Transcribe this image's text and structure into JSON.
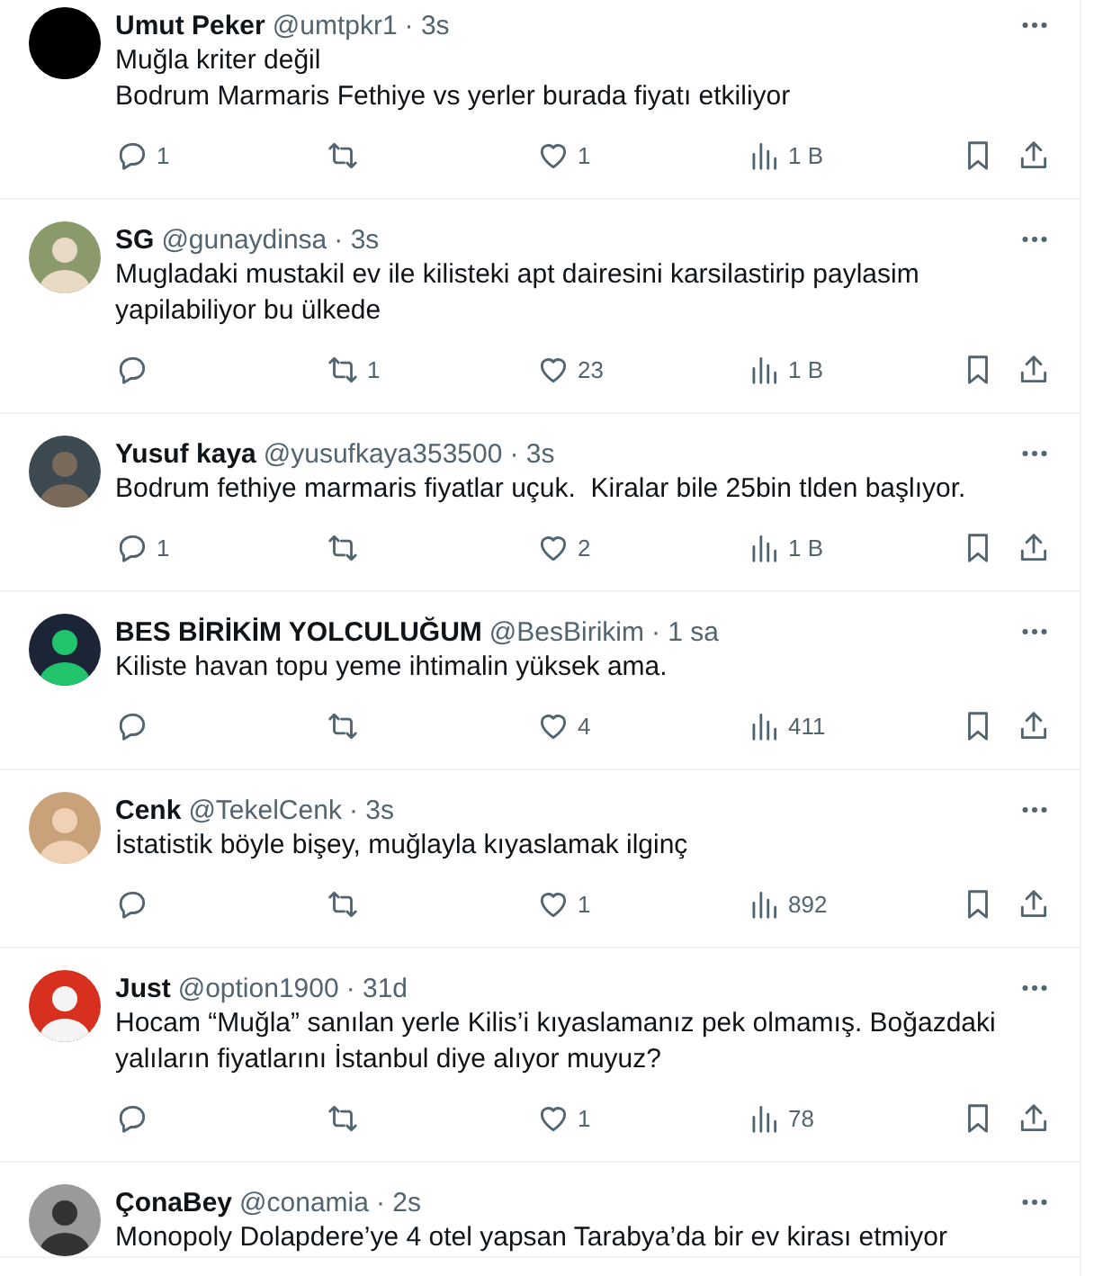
{
  "tweets": [
    {
      "name": "Umut Peker",
      "handle": "@umtpkr1",
      "time": "· 3s",
      "lines": [
        "Muğla kriter değil",
        "Bodrum Marmaris Fethiye vs yerler burada fiyatı etkiliyor"
      ],
      "actions": {
        "replies": "1",
        "likes": "1",
        "views": "1 B"
      }
    },
    {
      "name": "SG",
      "handle": "@gunaydinsa",
      "time": "· 3s",
      "lines": [
        "Mugladaki mustakil ev ile kilisteki apt dairesini karsilastirip paylasim",
        "yapilabiliyor bu ülkede"
      ],
      "actions": {
        "reposts": "1",
        "likes": "23",
        "views": "1 B"
      }
    },
    {
      "name": "Yusuf kaya",
      "handle": "@yusufkaya353500",
      "time": "· 3s",
      "lines": [
        "Bodrum fethiye marmaris fiyatlar uçuk.  Kiralar bile 25bin tlden başlıyor."
      ],
      "actions": {
        "replies": "1",
        "likes": "2",
        "views": "1 B"
      }
    },
    {
      "name": "BES BİRİKİM YOLCULUĞUM",
      "handle": "@BesBirikim",
      "time": "· 1 sa",
      "lines": [
        "Kiliste havan topu yeme ihtimalin yüksek ama."
      ],
      "actions": {
        "likes": "4",
        "views": "411"
      }
    },
    {
      "name": "Cenk",
      "handle": "@TekelCenk",
      "time": "· 3s",
      "lines": [
        "İstatistik böyle bişey, muğlayla kıyaslamak ilginç"
      ],
      "actions": {
        "likes": "1",
        "views": "892"
      }
    },
    {
      "name": "Just",
      "handle": "@option1900",
      "time": "· 31d",
      "lines": [
        "Hocam “Muğla” sanılan yerle Kilis’i kıyaslamanız pek olmamış. Boğazdaki",
        "yalıların fiyatlarını İstanbul diye alıyor muyuz?"
      ],
      "actions": {
        "likes": "1",
        "views": "78"
      }
    },
    {
      "name": "ÇonaBey",
      "handle": "@conamia",
      "time": "· 2s",
      "lines": [
        "Monopoly Dolapdere’ye 4 otel yapsan Tarabya’da bir ev kirası etmiyor"
      ]
    }
  ]
}
